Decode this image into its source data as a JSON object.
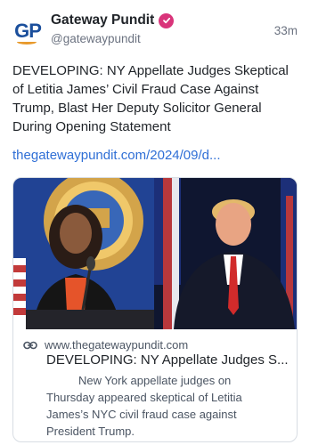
{
  "post": {
    "author": {
      "avatar_text": "GP",
      "display_name": "Gateway Pundit",
      "handle": "@gatewaypundit",
      "verified": true
    },
    "time": "33m",
    "text": "DEVELOPING: NY Appellate Judges Skeptical of Letitia James’ Civil Fraud Case Against Trump, Blast Her Deputy Solicitor General During Opening Statement",
    "link": "thegatewaypundit.com/2024/09/d...",
    "card": {
      "domain": "www.thegatewaypundit.com",
      "title": "DEVELOPING: NY Appellate Judges S...",
      "description": "New York appellate judges on Thursday appeared skeptical of Letitia James’s NYC civil fraud case against President Trump."
    }
  },
  "colors": {
    "verified": "#d9347a",
    "link": "#2f6fd6",
    "brand_blue": "#1b4f9c",
    "brand_orange": "#e89a2c"
  },
  "icons": {
    "verified": "verified-badge-icon",
    "link": "link-icon"
  }
}
